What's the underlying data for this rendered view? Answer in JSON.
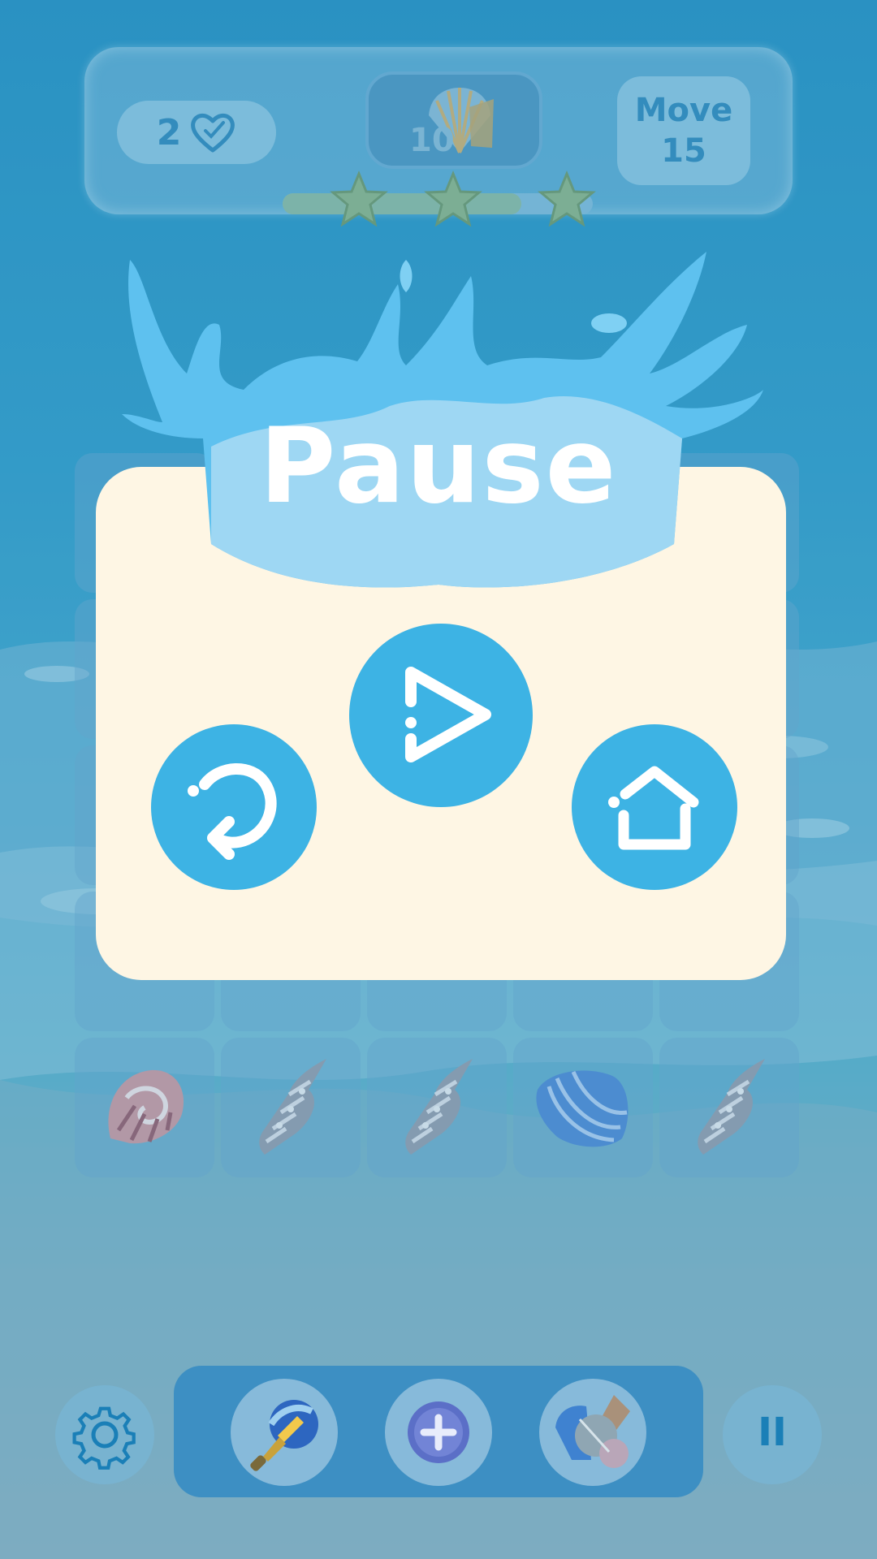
{
  "hud": {
    "lives": "2",
    "lives_icon": "heart-icon",
    "goal_count": "10",
    "goal_icon": "seashell-icon",
    "moves_label": "Move",
    "moves_value": "15",
    "progress": 0.77,
    "stars": 3
  },
  "board": {
    "rows": 5,
    "cols": 5,
    "visible_bottom_row": [
      "spiral-shell",
      "conch-shell",
      "conch-shell",
      "blue-clam-shell",
      "conch-shell"
    ]
  },
  "dialog": {
    "title": "Pause",
    "buttons": {
      "restart": "restart-icon",
      "resume": "play-icon",
      "home": "home-icon"
    }
  },
  "bottom": {
    "settings": "gear-icon",
    "boosters": [
      "paintbrush-icon",
      "plus-icon",
      "shells-icon"
    ],
    "pause_label": "II"
  },
  "colors": {
    "accent": "#3db3e4",
    "dialog_bg": "#fef6e4",
    "hud_text": "#1a7fb7"
  }
}
